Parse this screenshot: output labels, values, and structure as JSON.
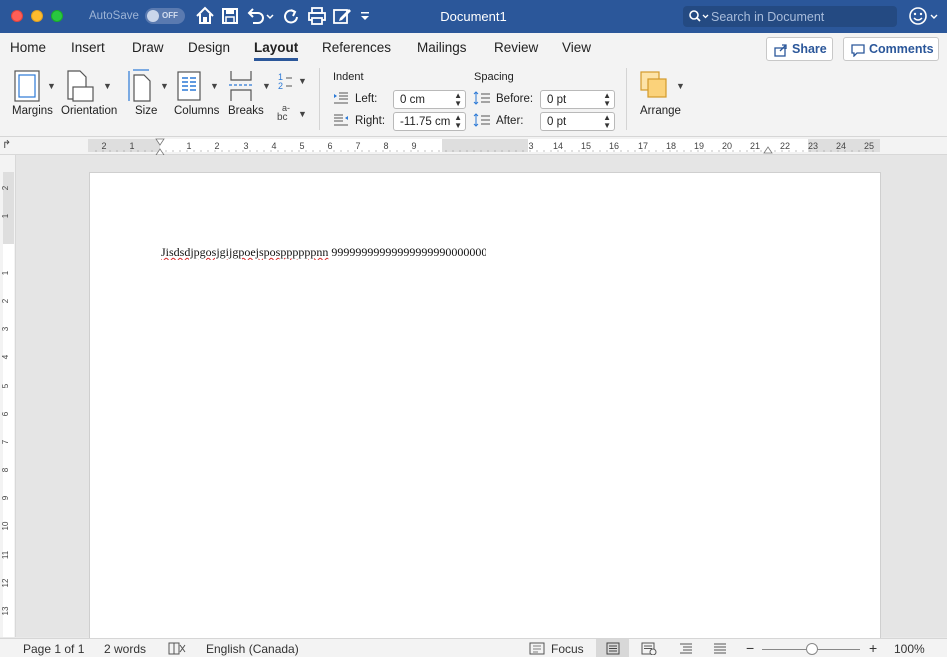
{
  "titlebar": {
    "autosave_label": "AutoSave",
    "autosave_state": "OFF",
    "document_title": "Document1",
    "search_placeholder": "Search in Document"
  },
  "tabs": [
    {
      "label": "Home"
    },
    {
      "label": "Insert"
    },
    {
      "label": "Draw"
    },
    {
      "label": "Design"
    },
    {
      "label": "Layout",
      "active": true
    },
    {
      "label": "References"
    },
    {
      "label": "Mailings"
    },
    {
      "label": "Review"
    },
    {
      "label": "View"
    }
  ],
  "actions": {
    "share_label": "Share",
    "comments_label": "Comments"
  },
  "ribbon": {
    "margins_label": "Margins",
    "orientation_label": "Orientation",
    "size_label": "Size",
    "columns_label": "Columns",
    "breaks_label": "Breaks",
    "indent_title": "Indent",
    "indent_left_label": "Left:",
    "indent_left_value": "0 cm",
    "indent_right_label": "Right:",
    "indent_right_value": "-11.75 cm",
    "spacing_title": "Spacing",
    "spacing_before_label": "Before:",
    "spacing_before_value": "0 pt",
    "spacing_after_label": "After:",
    "spacing_after_value": "0 pt",
    "arrange_label": "Arrange",
    "hyphen_glyph_a": "a-",
    "hyphen_glyph_b": "bc",
    "line_numbers_1": "1",
    "line_numbers_2": "2"
  },
  "ruler": {
    "labels": [
      "2",
      "1",
      "1",
      "2",
      "3",
      "4",
      "5",
      "6",
      "7",
      "8",
      "9",
      "3",
      "14",
      "15",
      "16",
      "17",
      "18",
      "19",
      "20",
      "21",
      "22",
      "23",
      "24",
      "25"
    ],
    "vlabels": [
      "2",
      "1",
      "1",
      "2",
      "3",
      "4",
      "5",
      "6",
      "7",
      "8",
      "9",
      "10",
      "11",
      "12",
      "13"
    ]
  },
  "document": {
    "text_misspelled": "Jisdsdjpgosjgijgpoejsposppppppnn",
    "text_rest": " 99999999999999999990000000("
  },
  "status": {
    "page": "Page 1 of 1",
    "words": "2 words",
    "language": "English (Canada)",
    "focus_label": "Focus",
    "zoom": "100%",
    "zoom_minus": "−",
    "zoom_plus": "+"
  },
  "colors": {
    "titlebar": "#2b579a",
    "accent": "#2b579a"
  }
}
